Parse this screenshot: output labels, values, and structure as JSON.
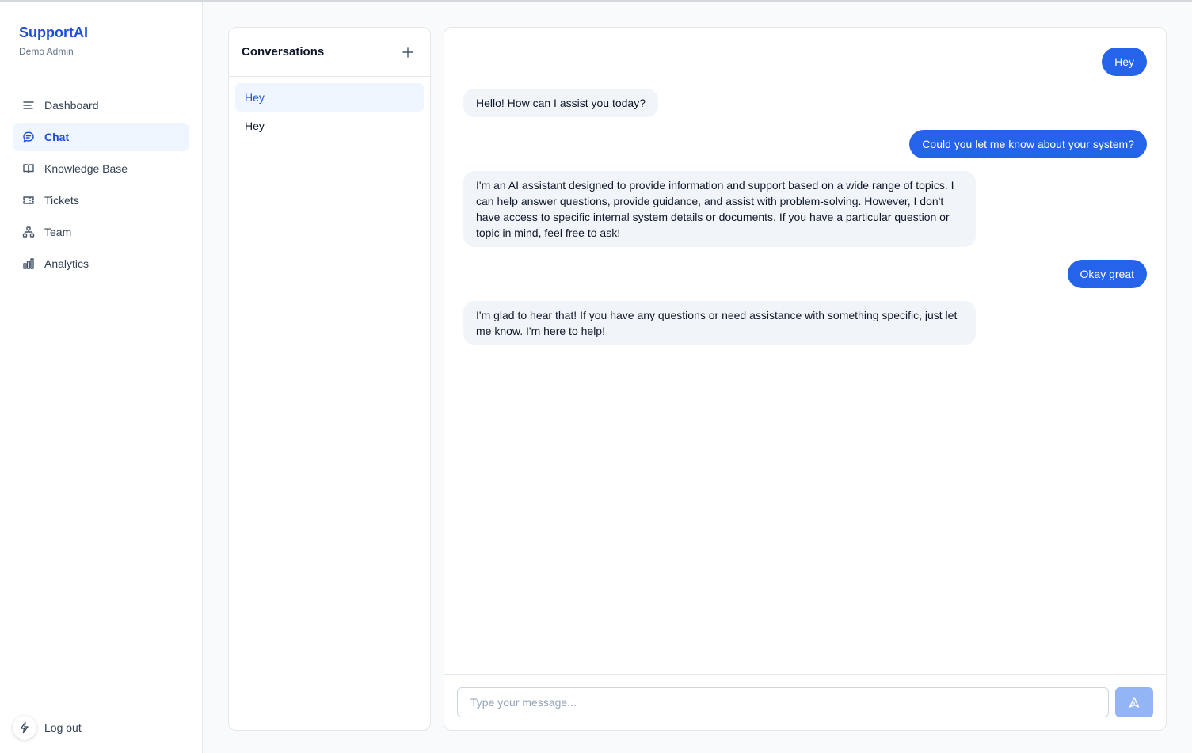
{
  "brand": {
    "name": "SupportAI",
    "subtitle": "Demo Admin"
  },
  "nav": {
    "items": [
      {
        "label": "Dashboard",
        "icon": "menu-lines-icon",
        "active": false
      },
      {
        "label": "Chat",
        "icon": "chat-bubble-icon",
        "active": true
      },
      {
        "label": "Knowledge Base",
        "icon": "book-icon",
        "active": false
      },
      {
        "label": "Tickets",
        "icon": "ticket-icon",
        "active": false
      },
      {
        "label": "Team",
        "icon": "team-icon",
        "active": false
      },
      {
        "label": "Analytics",
        "icon": "bar-chart-icon",
        "active": false
      }
    ]
  },
  "logout": {
    "label": "Log out",
    "icon": "bolt-icon"
  },
  "conversations": {
    "title": "Conversations",
    "items": [
      {
        "label": "Hey",
        "active": true
      },
      {
        "label": "Hey",
        "active": false
      }
    ]
  },
  "chat": {
    "messages": [
      {
        "role": "user",
        "text": "Hey"
      },
      {
        "role": "bot",
        "text": "Hello! How can I assist you today?"
      },
      {
        "role": "user",
        "text": "Could you let me know about your system?"
      },
      {
        "role": "bot",
        "text": "I'm an AI assistant designed to provide information and support based on a wide range of topics. I can help answer questions, provide guidance, and assist with problem-solving. However, I don't have access to specific internal system details or documents. If you have a particular question or topic in mind, feel free to ask!"
      },
      {
        "role": "user",
        "text": "Okay great"
      },
      {
        "role": "bot",
        "text": "I'm glad to hear that! If you have any questions or need assistance with something specific, just let me know. I'm here to help!"
      }
    ],
    "input": {
      "value": "",
      "placeholder": "Type your message..."
    }
  },
  "colors": {
    "accent": "#2563eb",
    "brand": "#1d4ed8",
    "active_bg": "#eff6ff",
    "send_disabled": "#93b4f5"
  }
}
